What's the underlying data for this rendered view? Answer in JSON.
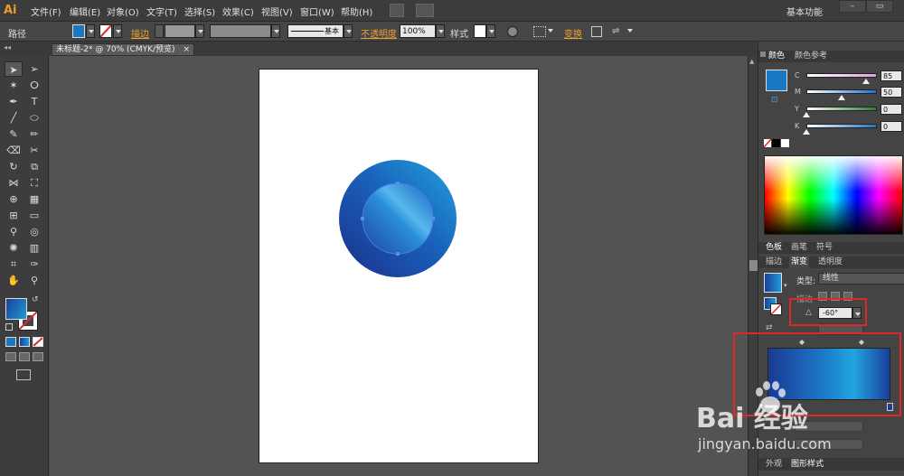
{
  "app": {
    "logo": "Ai",
    "workspace": "基本功能"
  },
  "menu": [
    "文件(F)",
    "编辑(E)",
    "对象(O)",
    "文字(T)",
    "选择(S)",
    "效果(C)",
    "视图(V)",
    "窗口(W)",
    "帮助(H)"
  ],
  "control": {
    "object_type": "路径",
    "stroke_label": "描边",
    "stroke_profile": "基本",
    "opacity_label": "不透明度",
    "opacity_value": "100%",
    "style_label": "样式",
    "transform_label": "变换"
  },
  "document": {
    "tab_title": "未标题-2* @ 70% (CMYK/预览)",
    "close_glyph": "×"
  },
  "colors": {
    "accent_orange": "#f0a030",
    "gradient_dark": "#1c3f9a",
    "gradient_light": "#1e9ad6",
    "fill_color": "#1a78c2",
    "highlight_red": "#e02828"
  },
  "color_panel": {
    "tabs": [
      "颜色",
      "颜色参考"
    ],
    "channels": [
      {
        "label": "C",
        "value": "85",
        "level": 0.85,
        "track": "#e0a0e0"
      },
      {
        "label": "M",
        "value": "50",
        "level": 0.5,
        "track": "#1e74d0"
      },
      {
        "label": "Y",
        "value": "0",
        "level": 0,
        "track": "#2a7a3a"
      },
      {
        "label": "K",
        "value": "0",
        "level": 0,
        "track": "#1e74c8"
      }
    ]
  },
  "swatch_panel": {
    "tabs": [
      "色板",
      "画笔",
      "符号"
    ]
  },
  "gradient_panel": {
    "tabs": [
      "描边",
      "渐变",
      "透明度"
    ],
    "type_label": "类型:",
    "type_value": "线性",
    "stroke_row_label": "描边",
    "angle_value": "-60°"
  },
  "bottom_tabs": [
    "外观",
    "图形样式"
  ],
  "watermark": {
    "brand": "Bai 经验",
    "url": "jingyan.baidu.com"
  }
}
